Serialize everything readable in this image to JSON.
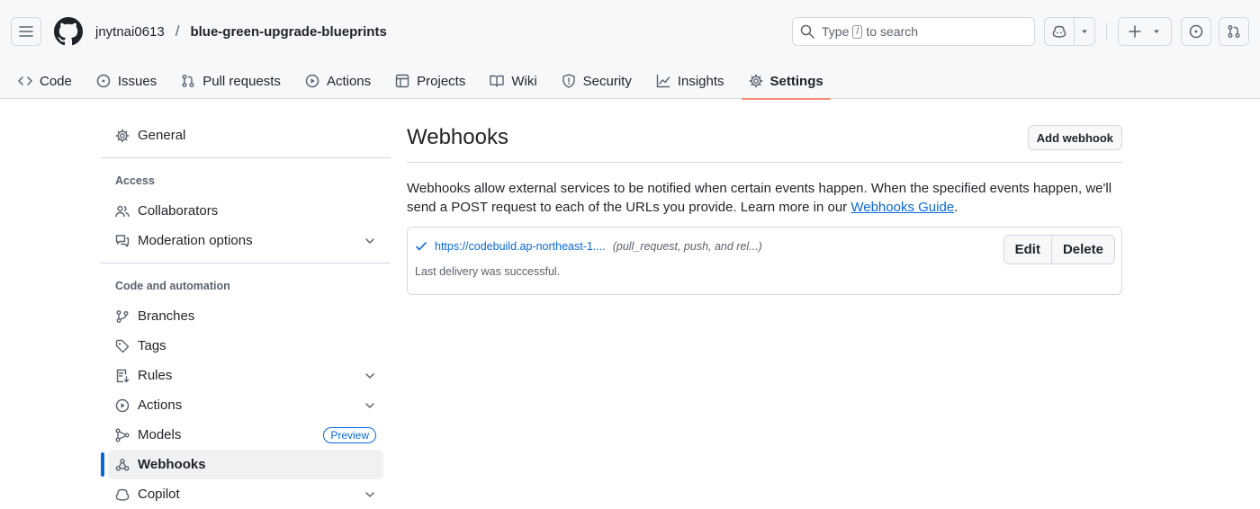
{
  "header": {
    "owner": "jnytnai0613",
    "separator": "/",
    "repo": "blue-green-upgrade-blueprints",
    "search": {
      "prefix": "Type",
      "key": "/",
      "suffix": "to search"
    }
  },
  "nav": {
    "tabs": [
      {
        "label": "Code",
        "icon": "code-icon"
      },
      {
        "label": "Issues",
        "icon": "issue-opened-icon"
      },
      {
        "label": "Pull requests",
        "icon": "git-pull-request-icon"
      },
      {
        "label": "Actions",
        "icon": "play-icon"
      },
      {
        "label": "Projects",
        "icon": "table-icon"
      },
      {
        "label": "Wiki",
        "icon": "book-icon"
      },
      {
        "label": "Security",
        "icon": "shield-icon"
      },
      {
        "label": "Insights",
        "icon": "graph-icon"
      },
      {
        "label": "Settings",
        "icon": "gear-icon",
        "active": true
      }
    ]
  },
  "sidebar": {
    "general": "General",
    "access_title": "Access",
    "collaborators": "Collaborators",
    "moderation": "Moderation options",
    "code_title": "Code and automation",
    "branches": "Branches",
    "tags": "Tags",
    "rules": "Rules",
    "actions": "Actions",
    "models": "Models",
    "models_badge": "Preview",
    "webhooks": "Webhooks",
    "copilot": "Copilot"
  },
  "main": {
    "title": "Webhooks",
    "add_button": "Add webhook",
    "description": "Webhooks allow external services to be notified when certain events happen. When the specified events happen, we'll send a POST request to each of the URLs you provide. Learn more in our ",
    "guide_link": "Webhooks Guide",
    "period": ".",
    "hook": {
      "url": "https://codebuild.ap-northeast-1....",
      "events": "(pull_request, push, and rel...)",
      "status": "Last delivery was successful.",
      "edit": "Edit",
      "delete": "Delete"
    }
  },
  "colors": {
    "accent": "#0969da",
    "tab_underline": "#fd8c73",
    "border": "#d1d9e0"
  }
}
